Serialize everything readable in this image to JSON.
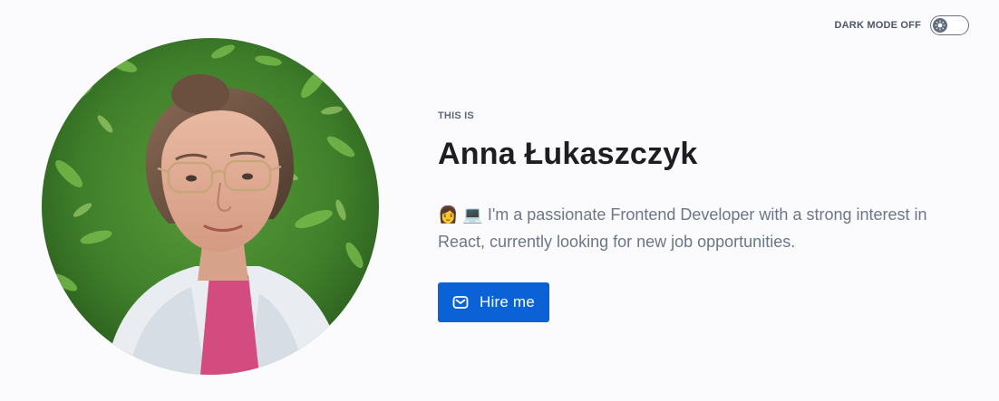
{
  "theme_toggle": {
    "label": "DARK MODE OFF",
    "state": "off",
    "icon": "sun-icon"
  },
  "profile": {
    "eyebrow": "THIS IS",
    "name": "Anna Łukaszczyk",
    "bio": "👩 💻 I'm a passionate Frontend Developer with a strong interest in React, currently looking for new job opportunities.",
    "cta_label": "Hire me",
    "cta_icon": "mail-icon"
  },
  "colors": {
    "background": "#fbfbfd",
    "accent": "#0b62d6",
    "name_text": "#1d1d22",
    "body_text": "#6b7688"
  }
}
